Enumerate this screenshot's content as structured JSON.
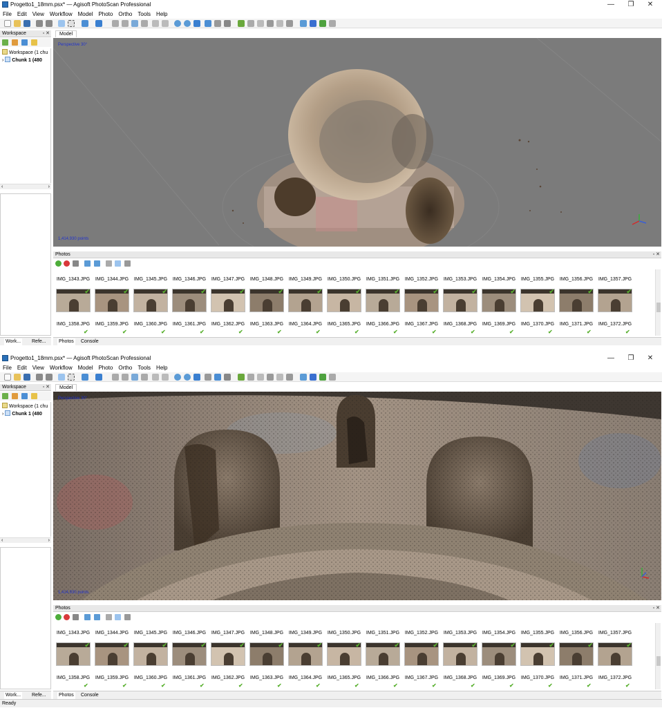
{
  "window_title": "Progetto1_18mm.psx* — Agisoft PhotoScan Professional",
  "window_controls": {
    "minimize": "—",
    "maximize": "❐",
    "close": "✕"
  },
  "menu": [
    "File",
    "Edit",
    "View",
    "Workflow",
    "Model",
    "Photo",
    "Ortho",
    "Tools",
    "Help"
  ],
  "workspace": {
    "title": "Workspace",
    "root_top": "Workspace (1 chu",
    "root_bottom": "Workspace (1 chu",
    "chunk": "Chunk 1 (480"
  },
  "left_tabs": [
    "Work...",
    "Refe..."
  ],
  "model_tab": "Model",
  "top_view": {
    "projection": "Perspective 30°",
    "point_count": "1,414,930 points"
  },
  "bottom_view": {
    "projection": "Perspective 30°",
    "point_count": "1,414,930 points"
  },
  "photos": {
    "title": "Photos",
    "row1": [
      "IMG_1343.JPG",
      "IMG_1344.JPG",
      "IMG_1345.JPG",
      "IMG_1346.JPG",
      "IMG_1347.JPG",
      "IMG_1348.JPG",
      "IMG_1349.JPG",
      "IMG_1350.JPG",
      "IMG_1351.JPG",
      "IMG_1352.JPG",
      "IMG_1353.JPG",
      "IMG_1354.JPG",
      "IMG_1355.JPG",
      "IMG_1356.JPG",
      "IMG_1357.JPG"
    ],
    "row2": [
      "IMG_1358.JPG",
      "IMG_1359.JPG",
      "IMG_1360.JPG",
      "IMG_1361.JPG",
      "IMG_1362.JPG",
      "IMG_1363.JPG",
      "IMG_1364.JPG",
      "IMG_1365.JPG",
      "IMG_1366.JPG",
      "IMG_1367.JPG",
      "IMG_1368.JPG",
      "IMG_1369.JPG",
      "IMG_1370.JPG",
      "IMG_1371.JPG",
      "IMG_1372.JPG"
    ]
  },
  "bottom_tabs": [
    "Photos",
    "Console"
  ],
  "status": "Ready",
  "colors": {
    "accent_check": "#59b02f",
    "viewport_gray": "#7b7b7b",
    "label_blue": "#2233cc"
  }
}
